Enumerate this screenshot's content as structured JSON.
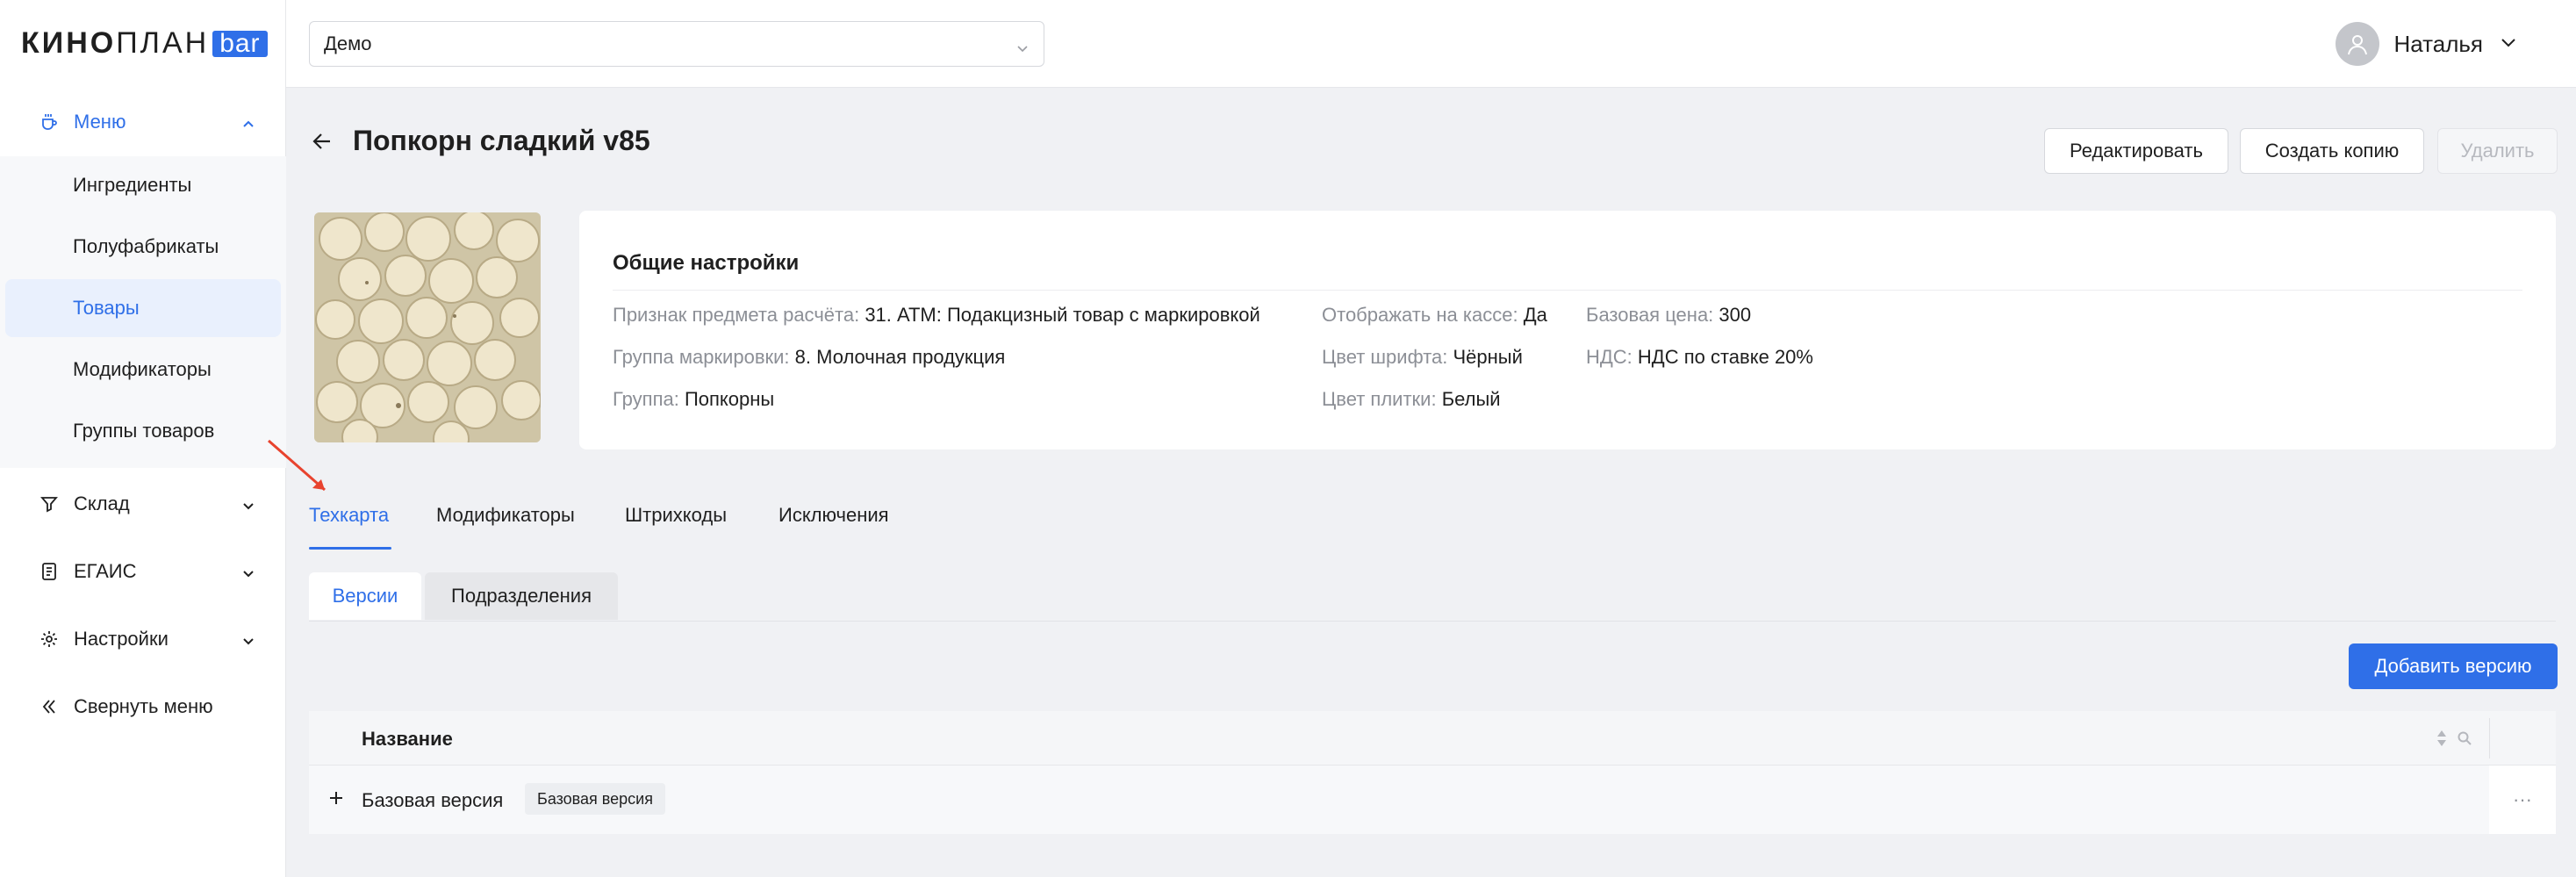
{
  "app": {
    "logo_main": "КИНО",
    "logo_thin": "ПЛАН",
    "logo_badge": "bar",
    "accent_color": "#2f6fe8"
  },
  "sidebar": {
    "groups": [
      {
        "label": "Меню",
        "icon": "coffee-cup-icon",
        "expanded": true
      },
      {
        "label": "Склад",
        "icon": "funnel-glass-icon",
        "expanded": false
      },
      {
        "label": "ЕГАИС",
        "icon": "document-icon",
        "expanded": false
      },
      {
        "label": "Настройки",
        "icon": "gear-icon",
        "expanded": false
      }
    ],
    "menu_items": [
      {
        "label": "Ингредиенты"
      },
      {
        "label": "Полуфабрикаты"
      },
      {
        "label": "Товары",
        "active": true
      },
      {
        "label": "Модификаторы"
      },
      {
        "label": "Группы товаров"
      }
    ],
    "collapse_label": "Свернуть меню"
  },
  "topbar": {
    "select_value": "Демо",
    "user_name": "Наталья"
  },
  "page": {
    "title": "Попкорн сладкий v85",
    "buttons": {
      "edit": "Редактировать",
      "copy": "Создать копию",
      "delete": "Удалить"
    }
  },
  "settings": {
    "title": "Общие настройки",
    "fields": {
      "payment_subject_key": "Признак предмета расчёта:",
      "payment_subject_val": "31. АТМ: Подакцизный товар с маркировкой",
      "marking_group_key": "Группа маркировки:",
      "marking_group_val": "8. Молочная продукция",
      "group_key": "Группа:",
      "group_val": "Попкорны",
      "show_cashbox_key": "Отображать на кассе:",
      "show_cashbox_val": "Да",
      "font_color_key": "Цвет шрифта:",
      "font_color_val": "Чёрный",
      "tile_color_key": "Цвет плитки:",
      "tile_color_val": "Белый",
      "base_price_key": "Базовая цена:",
      "base_price_val": "300",
      "vat_key": "НДС:",
      "vat_val": "НДС по ставке 20%"
    }
  },
  "tabs": [
    {
      "label": "Техкарта",
      "active": true
    },
    {
      "label": "Модификаторы"
    },
    {
      "label": "Штрихкоды"
    },
    {
      "label": "Исключения"
    }
  ],
  "subtabs": [
    {
      "label": "Версии",
      "active": true
    },
    {
      "label": "Подразделения"
    }
  ],
  "add_version_label": "Добавить версию",
  "table": {
    "column_name": "Название",
    "rows": [
      {
        "name": "Базовая версия",
        "badge": "Базовая версия",
        "actions": "···"
      }
    ]
  }
}
